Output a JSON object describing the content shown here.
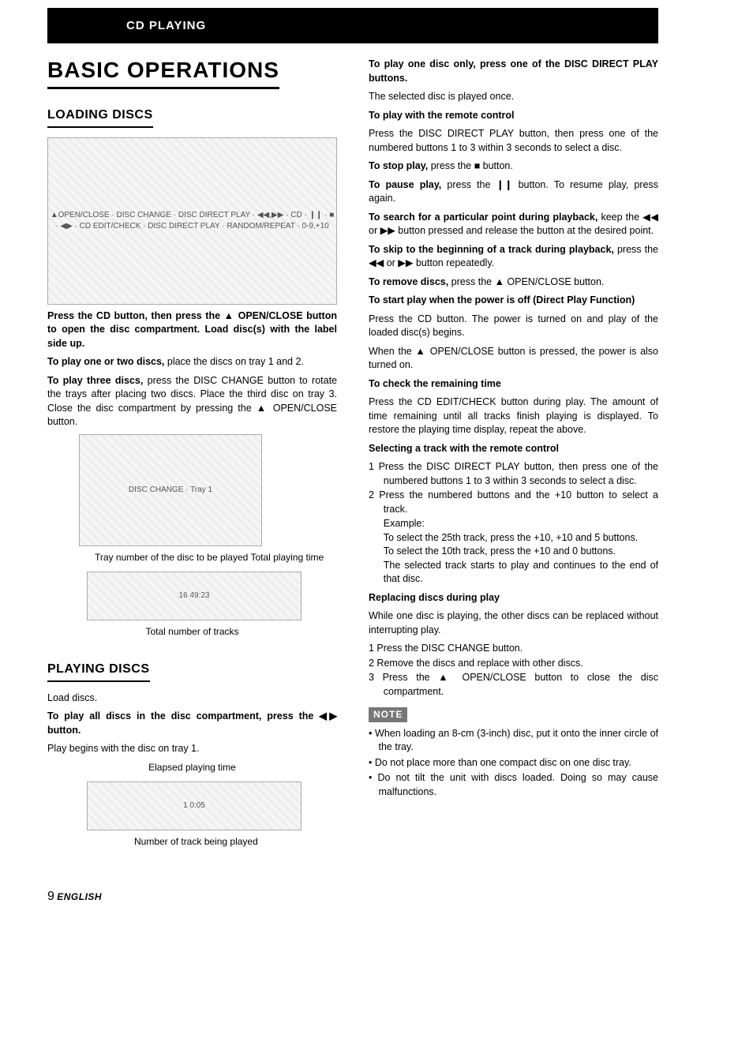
{
  "header": {
    "section_title": "CD PLAYING"
  },
  "title": "BASIC OPERATIONS",
  "left": {
    "loading_heading": "LOADING DISCS",
    "diagram1_labels": "▲OPEN/CLOSE · DISC CHANGE · DISC DIRECT PLAY · ◀◀,▶▶ · CD · ❙❙ · ■ · ◀▶ · CD EDIT/CHECK · DISC DIRECT PLAY · RANDOM/REPEAT · 0-9,+10",
    "press_cd_intro": "Press the CD button, then press the ▲ OPEN/CLOSE button to open the disc compartment. Load disc(s) with the label side up.",
    "play_one_two_bold": "To play one or two discs,",
    "play_one_two_rest": " place the discs on tray 1 and 2.",
    "play_three_bold": "To play three discs,",
    "play_three_rest": " press the DISC CHANGE button to rotate the trays after placing two discs. Place the third disc on tray 3. Close the disc compartment by pressing the ▲ OPEN/CLOSE button.",
    "diagram2_labels": "DISC CHANGE · Tray 1",
    "tray_caption_top": "Tray number of the disc to be played    Total playing time",
    "display1_text": "16  49:23",
    "tray_caption_bottom": "Total number of tracks",
    "playing_heading": "PLAYING DISCS",
    "load_discs": "Load discs.",
    "play_all_bold": "To play all discs in the disc compartment, press the ◀▶ button.",
    "play_begins": "Play begins with the disc on tray 1.",
    "elapsed_caption": "Elapsed playing time",
    "display2_text": "1  0:05",
    "number_caption": "Number of track being played"
  },
  "right": {
    "play_one_disc_heading": "To play one disc only, press one of the DISC DIRECT PLAY buttons.",
    "play_one_disc_body": "The selected disc is played once.",
    "remote_heading": "To play with the remote control",
    "remote_body": "Press the DISC DIRECT PLAY button, then press one of the numbered buttons 1 to 3 within 3 seconds to select a disc.",
    "stop_bold": "To stop play,",
    "stop_rest": " press the ■ button.",
    "pause_bold": "To pause play,",
    "pause_rest": " press the ❙❙ button. To resume play, press again.",
    "search_bold": "To search for a particular point during playback,",
    "search_rest": " keep the ◀◀ or ▶▶ button pressed and release the button at the desired point.",
    "skip_bold": "To skip to the beginning of a track during playback,",
    "skip_rest": " press the ◀◀ or ▶▶ button repeatedly.",
    "remove_bold": "To remove discs,",
    "remove_rest": " press the ▲ OPEN/CLOSE button.",
    "direct_play_heading": "To start play when the power is off (Direct Play Function)",
    "direct_play_body1": "Press the CD button. The power is turned on and play of the loaded disc(s) begins.",
    "direct_play_body2": "When the ▲ OPEN/CLOSE button is pressed, the power is also turned on.",
    "check_heading": "To check the remaining time",
    "check_body": "Press the CD EDIT/CHECK button during play. The amount of time remaining until all tracks finish playing is displayed. To restore the playing time display, repeat the above.",
    "select_heading": "Selecting a track with the remote control",
    "select_1": "1   Press the DISC DIRECT PLAY button, then press one of the numbered buttons 1 to 3 within 3 seconds to select a disc.",
    "select_2": "2   Press the numbered buttons and the +10 button to select a track.",
    "select_example": "Example:",
    "select_ex1": "To select the 25th track, press the +10, +10 and 5 buttons.",
    "select_ex2": "To select the 10th track, press the +10 and 0 buttons.",
    "select_ex3": "The selected track starts to play and continues to the end of that disc.",
    "replace_heading": "Replacing discs during play",
    "replace_intro": "While one disc is playing, the other discs can be replaced without interrupting play.",
    "replace_1": "1   Press the DISC CHANGE button.",
    "replace_2": "2   Remove the discs and replace with other discs.",
    "replace_3": "3   Press the ▲ OPEN/CLOSE button to close the disc compartment.",
    "note_label": "NOTE",
    "note_1": "When loading an 8-cm (3-inch) disc, put it onto the inner circle of the tray.",
    "note_2": "Do not place more than one compact disc on one disc tray.",
    "note_3": "Do not tilt the unit with discs loaded. Doing so may cause malfunctions."
  },
  "footer": {
    "page": "9",
    "lang": "ENGLISH"
  }
}
